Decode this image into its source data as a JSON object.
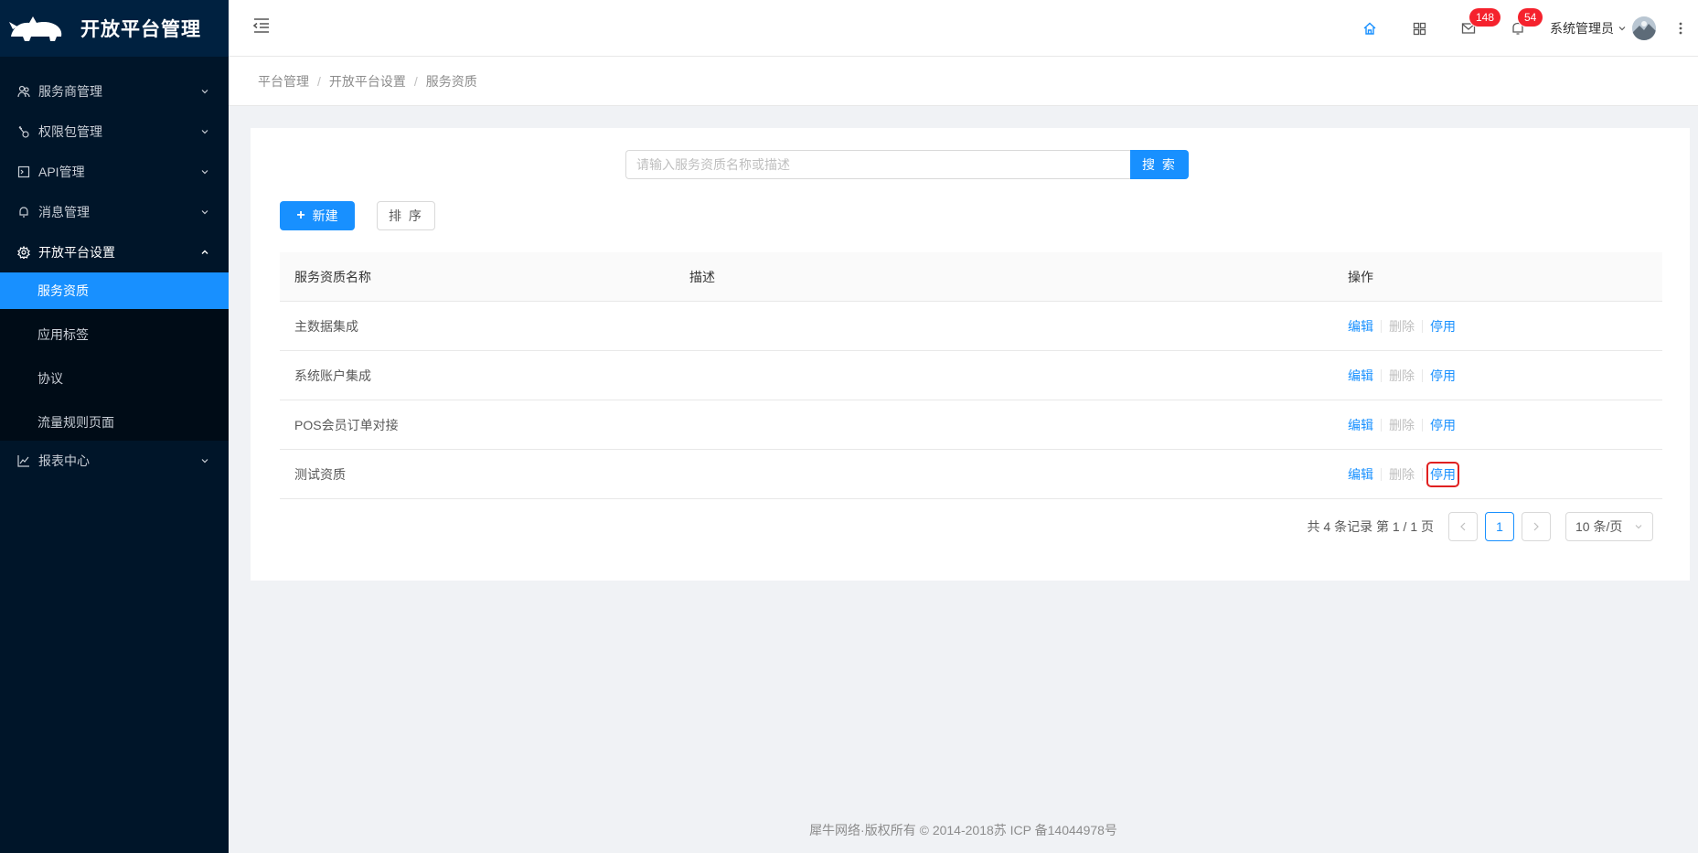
{
  "app": {
    "title": "开放平台管理"
  },
  "sidebar": {
    "items": [
      {
        "label": "服务商管理",
        "icon": "team-icon"
      },
      {
        "label": "权限包管理",
        "icon": "key-icon"
      },
      {
        "label": "API管理",
        "icon": "api-icon"
      },
      {
        "label": "消息管理",
        "icon": "bell-icon"
      },
      {
        "label": "开放平台设置",
        "icon": "gear-icon"
      },
      {
        "label": "报表中心",
        "icon": "line-chart-icon"
      }
    ],
    "submenu": [
      {
        "label": "服务资质"
      },
      {
        "label": "应用标签"
      },
      {
        "label": "协议"
      },
      {
        "label": "流量规则页面"
      }
    ]
  },
  "header": {
    "mail_badge": "148",
    "notice_badge": "54",
    "user_name": "系统管理员"
  },
  "breadcrumb": [
    "平台管理",
    "开放平台设置",
    "服务资质"
  ],
  "search": {
    "placeholder": "请输入服务资质名称或描述",
    "button": "搜 索"
  },
  "toolbar": {
    "new_label": "新建",
    "sort_label": "排 序"
  },
  "table": {
    "columns": {
      "name": "服务资质名称",
      "desc": "描述",
      "op": "操作"
    },
    "rows": [
      {
        "name": "主数据集成",
        "desc": "",
        "edit": "编辑",
        "delete": "删除",
        "disable": "停用"
      },
      {
        "name": "系统账户集成",
        "desc": "",
        "edit": "编辑",
        "delete": "删除",
        "disable": "停用"
      },
      {
        "name": "POS会员订单对接",
        "desc": "",
        "edit": "编辑",
        "delete": "删除",
        "disable": "停用"
      },
      {
        "name": "测试资质",
        "desc": "",
        "edit": "编辑",
        "delete": "删除",
        "disable": "停用"
      }
    ]
  },
  "pagination": {
    "total_text": "共 4 条记录 第 1 / 1 页",
    "current": "1",
    "page_size": "10 条/页"
  },
  "footer": {
    "text": "犀牛网络·版权所有 © 2014-2018苏 ICP 备14044978号"
  },
  "colors": {
    "primary": "#1890ff",
    "sidebar_bg": "#001529",
    "badge": "#f5222d",
    "highlight": "#e02020"
  }
}
